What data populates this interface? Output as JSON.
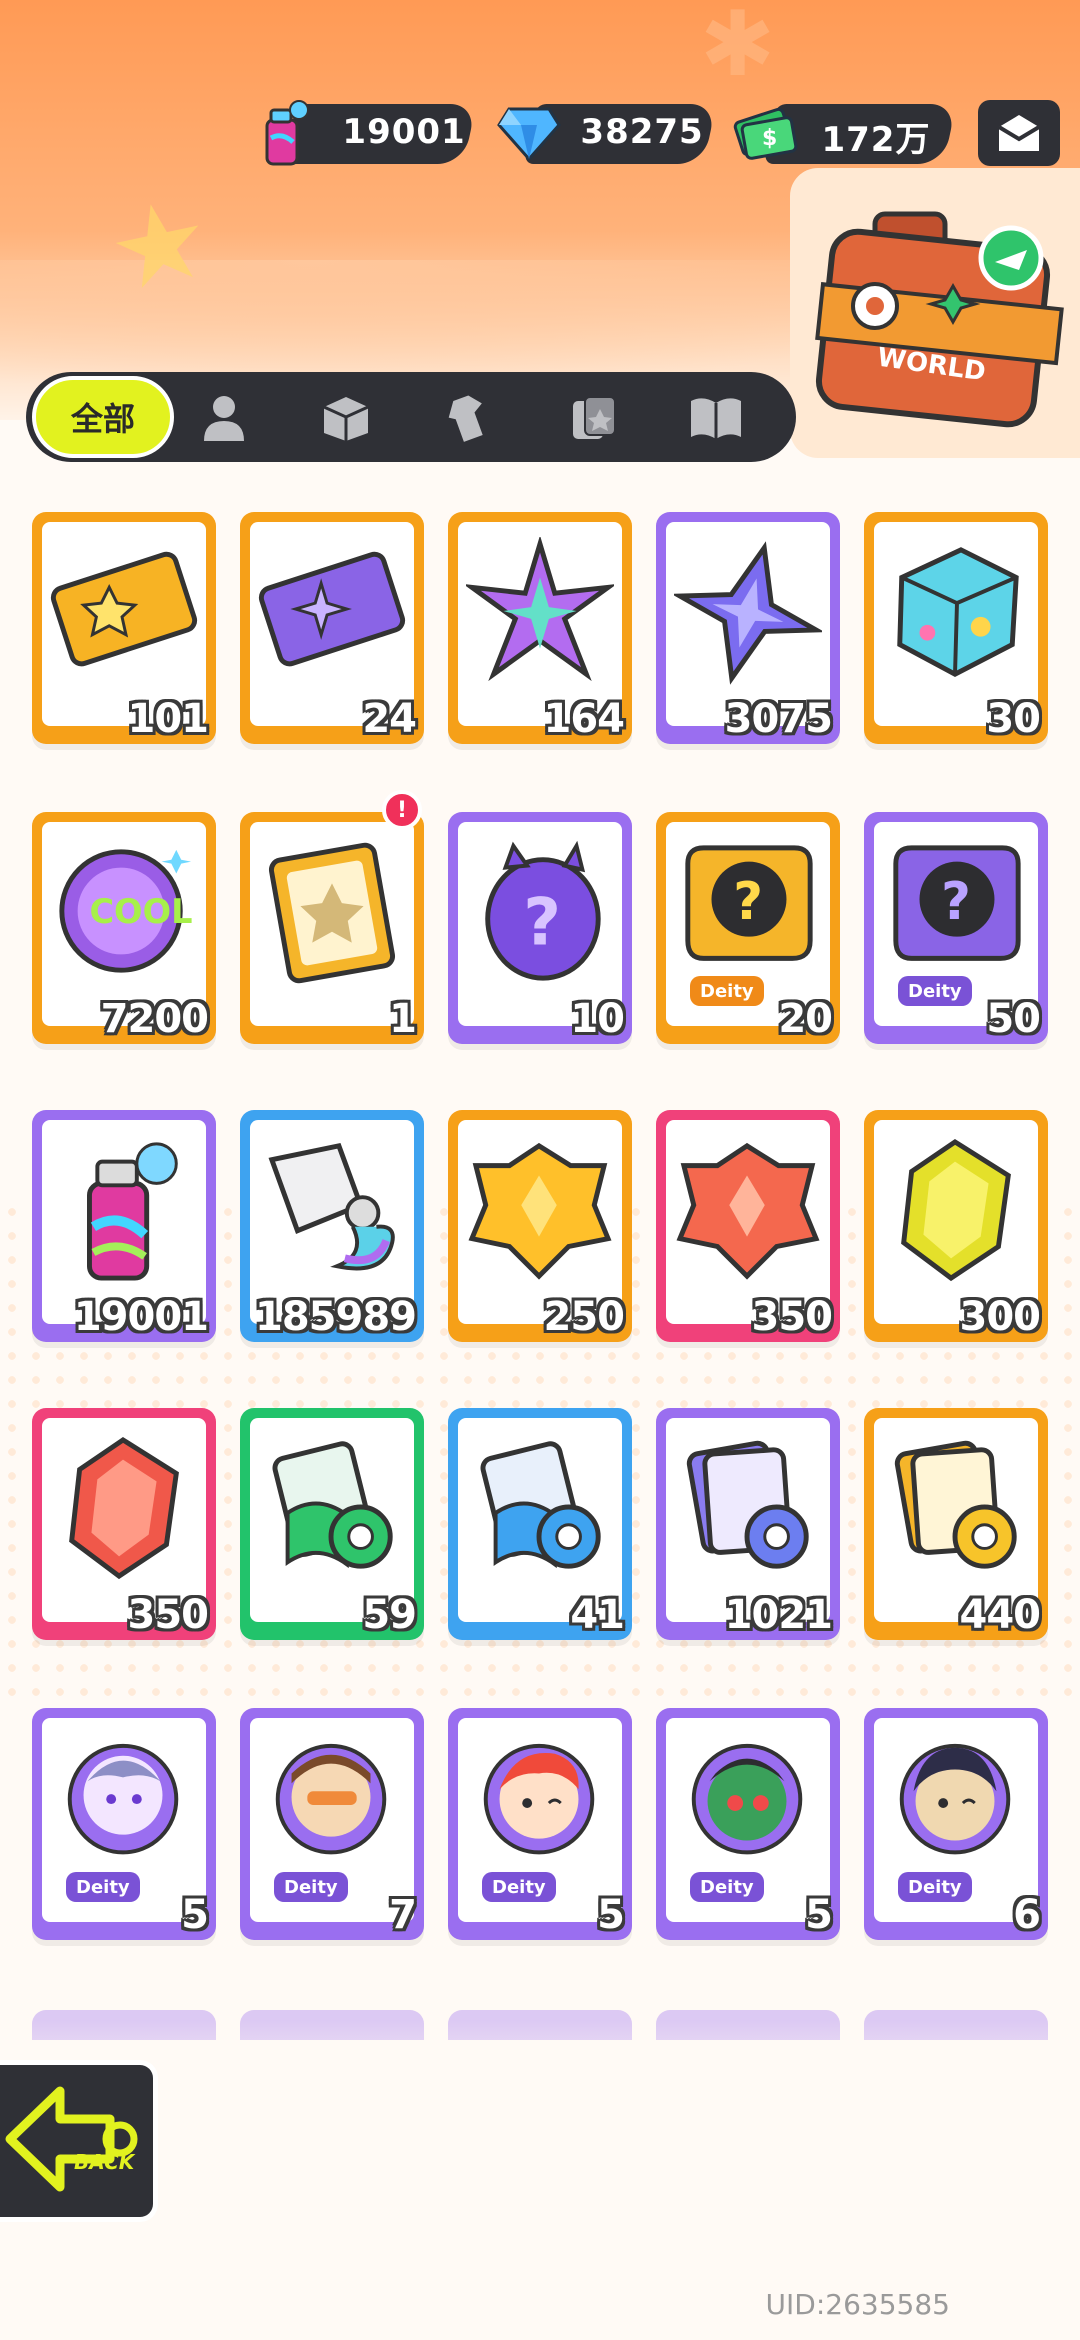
{
  "currencies": [
    {
      "name": "spray-paint",
      "value": "19001"
    },
    {
      "name": "diamond",
      "value": "38275"
    },
    {
      "name": "cash",
      "value": "172万"
    }
  ],
  "tabs": {
    "active_label": "全部",
    "icons": [
      "person-icon",
      "box-icon",
      "shirt-icon",
      "cards-icon",
      "book-icon"
    ]
  },
  "suitcase": {
    "label": "WORLD"
  },
  "items": [
    {
      "icon": "gold-ticket",
      "count": "101",
      "rarity": "orange"
    },
    {
      "icon": "purple-ticket",
      "count": "24",
      "rarity": "orange"
    },
    {
      "icon": "rainbow-star-shard",
      "count": "164",
      "rarity": "orange"
    },
    {
      "icon": "purple-star-shard",
      "count": "3075",
      "rarity": "purple"
    },
    {
      "icon": "paint-cube",
      "count": "30",
      "rarity": "orange"
    },
    {
      "icon": "cool-badge",
      "count": "7200",
      "rarity": "orange"
    },
    {
      "icon": "travel-card",
      "count": "1",
      "rarity": "orange"
    },
    {
      "icon": "mystery-egg",
      "count": "10",
      "rarity": "purple"
    },
    {
      "icon": "deity-mystery-gold",
      "count": "20",
      "rarity": "orange"
    },
    {
      "icon": "deity-mystery-purple",
      "count": "50",
      "rarity": "purple"
    },
    {
      "icon": "spray-can",
      "count": "19001",
      "rarity": "purple"
    },
    {
      "icon": "paint-tube",
      "count": "185989",
      "rarity": "blue"
    },
    {
      "icon": "gold-crystal",
      "count": "250",
      "rarity": "orange"
    },
    {
      "icon": "red-crystal",
      "count": "350",
      "rarity": "pink"
    },
    {
      "icon": "yellow-gem",
      "count": "300",
      "rarity": "orange"
    },
    {
      "icon": "red-gem",
      "count": "350",
      "rarity": "pink"
    },
    {
      "icon": "green-card-roll",
      "count": "59",
      "rarity": "green"
    },
    {
      "icon": "blue-card-roll",
      "count": "41",
      "rarity": "blue"
    },
    {
      "icon": "purple-card-roll",
      "count": "1021",
      "rarity": "purple"
    },
    {
      "icon": "gold-card-roll",
      "count": "440",
      "rarity": "orange"
    },
    {
      "icon": "deity-avatar-1",
      "count": "5",
      "rarity": "purple"
    },
    {
      "icon": "deity-avatar-2",
      "count": "7",
      "rarity": "purple"
    },
    {
      "icon": "deity-avatar-3",
      "count": "5",
      "rarity": "purple"
    },
    {
      "icon": "deity-avatar-4",
      "count": "5",
      "rarity": "purple"
    },
    {
      "icon": "deity-avatar-5",
      "count": "6",
      "rarity": "purple"
    }
  ],
  "deity_label": "Deity",
  "notification_badge": "!",
  "back_label": "BACK",
  "uid": "UID:2635585",
  "colors": {
    "orange": "#f6a018",
    "purple": "#9a6ef0",
    "blue": "#3ea3f0",
    "pink": "#f0417a",
    "green": "#22c36b",
    "accent_yellow": "#e2f21f",
    "dark": "#2f3036"
  }
}
